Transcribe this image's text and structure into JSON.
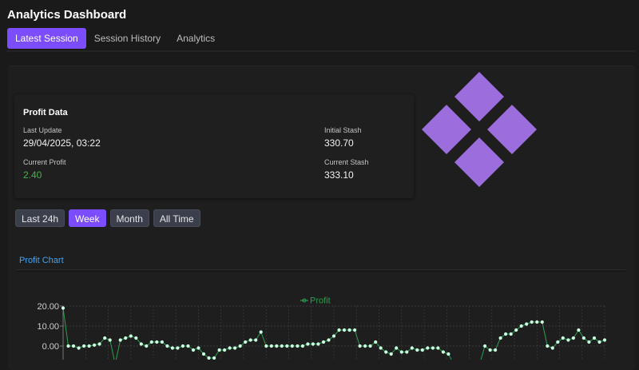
{
  "header": {
    "title": "Analytics Dashboard",
    "tabs": [
      {
        "label": "Latest Session",
        "active": true
      },
      {
        "label": "Session History",
        "active": false
      },
      {
        "label": "Analytics",
        "active": false
      }
    ]
  },
  "profit_card": {
    "title": "Profit Data",
    "last_update_label": "Last Update",
    "last_update_value": "29/04/2025, 03:22",
    "initial_stash_label": "Initial Stash",
    "initial_stash_value": "330.70",
    "current_profit_label": "Current Profit",
    "current_profit_value": "2.40",
    "current_stash_label": "Current Stash",
    "current_stash_value": "333.10"
  },
  "range_buttons": [
    {
      "label": "Last 24h",
      "active": false
    },
    {
      "label": "Week",
      "active": true
    },
    {
      "label": "Month",
      "active": false
    },
    {
      "label": "All Time",
      "active": false
    }
  ],
  "chart_section": {
    "title": "Profit Chart"
  },
  "colors": {
    "accent": "#7c4dff",
    "profit_positive": "#4caf50",
    "series_line": "#2e9e4f",
    "point_fill": "#c8ffe0",
    "chart_title": "#42a5f5",
    "logo": "#9c6ddd"
  },
  "chart_data": {
    "type": "line",
    "title": "",
    "xlabel": "",
    "ylabel": "",
    "ylim": [
      -5,
      20
    ],
    "yticks": [
      "20.00",
      "10.00",
      "0.00"
    ],
    "grid": true,
    "legend": "top-center",
    "series": [
      {
        "name": "Profit",
        "values": [
          19,
          0,
          0,
          -1,
          0,
          0,
          0.5,
          1,
          4,
          3,
          -9,
          3,
          4,
          5,
          4,
          1,
          0,
          2,
          2,
          2,
          0,
          -1,
          -1,
          0,
          0,
          -2,
          -1,
          -4,
          -6,
          -6,
          -2,
          -2,
          -1,
          -1,
          0,
          2,
          3,
          3,
          7,
          0,
          0,
          0,
          0,
          0,
          0,
          0,
          0,
          1,
          1,
          1,
          2,
          3,
          5,
          8,
          8,
          8,
          8,
          0,
          0,
          0,
          2,
          -1,
          -3,
          -4,
          -1,
          -3,
          -3,
          -1,
          -2,
          -2,
          -1,
          -1,
          -1,
          -3,
          -4,
          -9,
          -9,
          -9,
          -9,
          -9,
          -9,
          0,
          -2,
          -2,
          4,
          6,
          6,
          8,
          10,
          11,
          12,
          12,
          12,
          0,
          -1,
          2,
          4,
          3,
          4,
          8,
          4,
          2,
          4,
          2,
          3
        ]
      }
    ]
  }
}
